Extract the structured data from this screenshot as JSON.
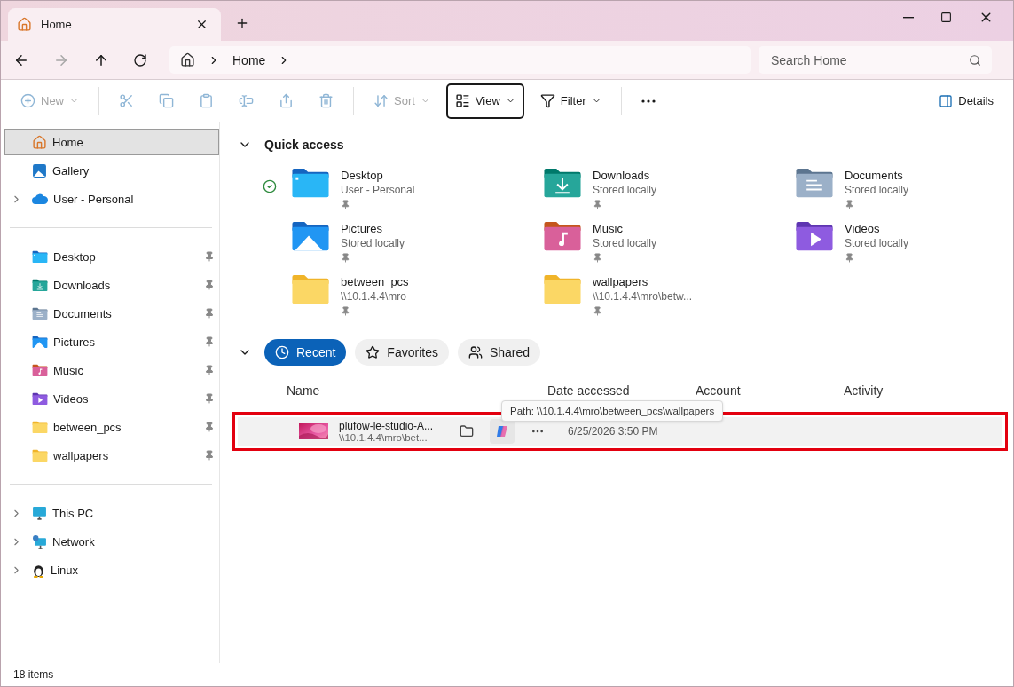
{
  "tabs": [
    {
      "title": "Home",
      "selected": true
    }
  ],
  "address": {
    "segments": [
      "Home"
    ]
  },
  "search": {
    "placeholder": "Search Home"
  },
  "toolbar": [
    {
      "kind": "menu",
      "label": "New",
      "disabled": true,
      "focused": false
    },
    {
      "kind": "icon",
      "disabled": true,
      "focused": false
    },
    {
      "kind": "icon",
      "disabled": true,
      "focused": false
    },
    {
      "kind": "icon",
      "disabled": true,
      "focused": false
    },
    {
      "kind": "icon",
      "disabled": true,
      "focused": false
    },
    {
      "kind": "icon",
      "disabled": true,
      "focused": false
    },
    {
      "kind": "icon",
      "disabled": true,
      "focused": false
    },
    {
      "kind": "menu",
      "label": "Sort",
      "disabled": true,
      "focused": false
    },
    {
      "kind": "menu",
      "label": "View",
      "disabled": false,
      "focused": true
    },
    {
      "kind": "menu",
      "label": "Filter",
      "disabled": false,
      "focused": false
    },
    {
      "kind": "icon",
      "disabled": false,
      "focused": false
    }
  ],
  "details": {
    "label": "Details"
  },
  "sidebar": {
    "groups": [
      [
        {
          "kind": "home",
          "label": "Home",
          "selected": true,
          "pinned": false
        },
        {
          "kind": "gallery",
          "label": "Gallery",
          "selected": false,
          "pinned": false
        },
        {
          "kind": "cloud",
          "label": "User - Personal",
          "selected": false,
          "pinned": false,
          "expanded": false
        }
      ],
      [
        {
          "kind": "desktop",
          "label": "Desktop",
          "selected": false,
          "pinned": true
        },
        {
          "kind": "downloads",
          "label": "Downloads",
          "selected": false,
          "pinned": true
        },
        {
          "kind": "documents",
          "label": "Documents",
          "selected": false,
          "pinned": true
        },
        {
          "kind": "pictures",
          "label": "Pictures",
          "selected": false,
          "pinned": true
        },
        {
          "kind": "music",
          "label": "Music",
          "selected": false,
          "pinned": true
        },
        {
          "kind": "videos",
          "label": "Videos",
          "selected": false,
          "pinned": true
        },
        {
          "kind": "folder",
          "label": "between_pcs",
          "selected": false,
          "pinned": true
        },
        {
          "kind": "folder",
          "label": "wallpapers",
          "selected": false,
          "pinned": true
        }
      ],
      [
        {
          "kind": "pc",
          "label": "This PC",
          "selected": false,
          "pinned": false,
          "expanded": false
        },
        {
          "kind": "network",
          "label": "Network",
          "selected": false,
          "pinned": false,
          "expanded": false
        },
        {
          "kind": "linux",
          "label": "Linux",
          "selected": false,
          "pinned": false,
          "expanded": false
        }
      ]
    ]
  },
  "quick_access": {
    "title": "Quick access",
    "expanded": true,
    "items": [
      {
        "kind": "desktop",
        "name": "Desktop",
        "detail": "User - Personal",
        "pinned": true,
        "synced": true
      },
      {
        "kind": "downloads",
        "name": "Downloads",
        "detail": "Stored locally",
        "pinned": true,
        "synced": false
      },
      {
        "kind": "documents",
        "name": "Documents",
        "detail": "Stored locally",
        "pinned": true,
        "synced": false
      },
      {
        "kind": "pictures",
        "name": "Pictures",
        "detail": "Stored locally",
        "pinned": true,
        "synced": false
      },
      {
        "kind": "music",
        "name": "Music",
        "detail": "Stored locally",
        "pinned": true,
        "synced": false
      },
      {
        "kind": "videos",
        "name": "Videos",
        "detail": "Stored locally",
        "pinned": true,
        "synced": false
      },
      {
        "kind": "folder",
        "name": "between_pcs",
        "detail": "\\\\10.1.4.4\\mro",
        "pinned": true,
        "synced": false
      },
      {
        "kind": "folder",
        "name": "wallpapers",
        "detail": "\\\\10.1.4.4\\mro\\betw...",
        "pinned": true,
        "synced": false
      }
    ]
  },
  "recent": {
    "expanded": true,
    "filters": [
      {
        "label": "Recent",
        "selected": true
      },
      {
        "label": "Favorites",
        "selected": false
      },
      {
        "label": "Shared",
        "selected": false
      }
    ],
    "columns": [
      "Name",
      "Date accessed",
      "Account",
      "Activity"
    ],
    "rows": [
      {
        "name": "plufow-le-studio-A...",
        "path": "\\\\10.1.4.4\\mro\\bet...",
        "date": "6/25/2026 3:50 PM",
        "highlighted": true
      }
    ],
    "tooltip": "Path: \\\\10.1.4.4\\mro\\between_pcs\\wallpapers"
  },
  "status_bar": {
    "count": "18 items"
  }
}
